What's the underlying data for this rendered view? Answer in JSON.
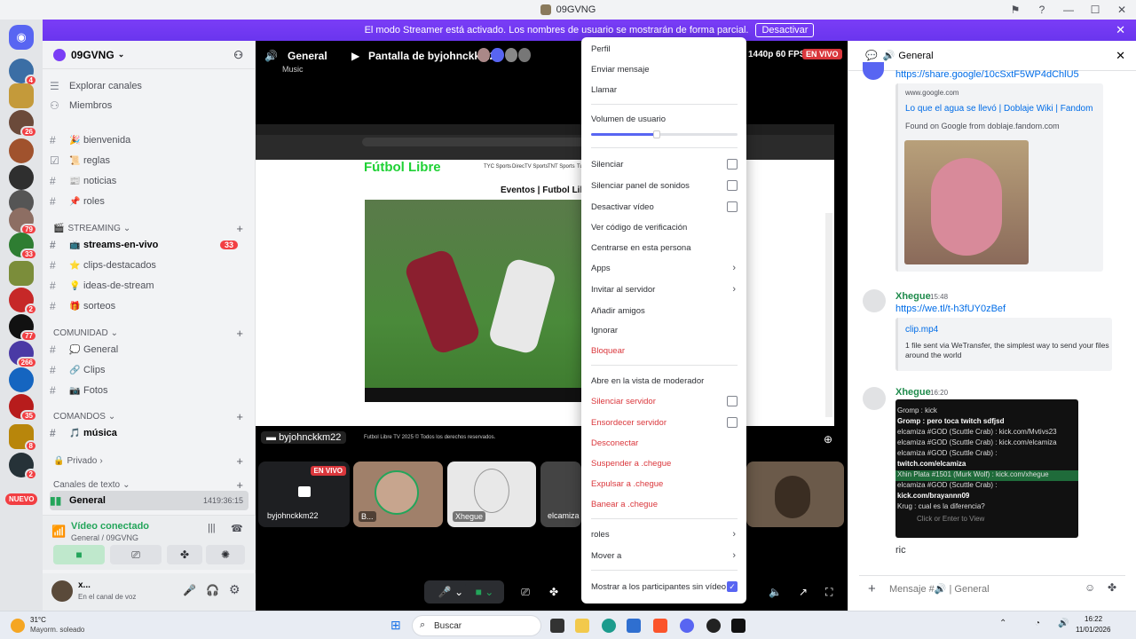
{
  "window": {
    "title": "09GVNG"
  },
  "banner": {
    "text": "El modo Streamer está activado. Los nombres de usuario se mostrarán de forma parcial.",
    "button": "Desactivar"
  },
  "guild_badges": [
    "4",
    "26",
    "",
    "",
    "",
    "79",
    "33",
    "",
    "2",
    "77",
    "266",
    "",
    "35",
    "8",
    "2"
  ],
  "new_badge": "NUEVO",
  "server": {
    "name": "09GVNG"
  },
  "nav": {
    "browse": "Explorar canales",
    "members": "Miembros"
  },
  "channels_top": [
    {
      "emoji": "🎉",
      "name": "bienvenida"
    },
    {
      "emoji": "📜",
      "name": "reglas"
    },
    {
      "emoji": "📰",
      "name": "noticias"
    },
    {
      "emoji": "📌",
      "name": "roles"
    }
  ],
  "cat_streaming": "STREAMING",
  "channels_streaming": [
    {
      "emoji": "📺",
      "name": "streams-en-vivo",
      "count": "33"
    },
    {
      "emoji": "⭐",
      "name": "clips-destacados",
      "count": ""
    },
    {
      "emoji": "💡",
      "name": "ideas-de-stream",
      "count": ""
    },
    {
      "emoji": "🎁",
      "name": "sorteos",
      "count": ""
    }
  ],
  "cat_comunidad": "COMUNIDAD",
  "channels_comunidad": [
    {
      "emoji": "💭",
      "name": "General"
    },
    {
      "emoji": "🔗",
      "name": "Clips"
    },
    {
      "emoji": "📷",
      "name": "Fotos"
    }
  ],
  "cat_comandos": "COMANDOS",
  "channel_musica": {
    "emoji": "🎵",
    "name": "música"
  },
  "cat_private": "Privade",
  "cat_private_label": "Privado",
  "cat_text": "Canales de texto",
  "voice_channel": {
    "name": "General",
    "time": "1419:36:15"
  },
  "voice": {
    "status": "Vídeo conectado",
    "location": "General / 09GVNG"
  },
  "user": {
    "name": "x...",
    "status": "En el canal de voz"
  },
  "stage": {
    "channel": "General",
    "sub": "Music",
    "screen_title": "Pantalla de byjohnckkm22",
    "quality": "1440p 60 FPS",
    "live": "EN VIVO",
    "streamer_tag": "byjohnckkm22",
    "site_title": "Fútbol Libre",
    "site_sub": "Eventos | Futbol Libr",
    "site_footer": "Futbol Libre TV 2025 © Todos los derechos reservados.",
    "nav_links": [
      "TYC Sports",
      "DirecTV Sports",
      "TNT Sports",
      "Tu"
    ]
  },
  "tiles": [
    {
      "name": "byjohnckkm22",
      "live": "EN VIVO"
    },
    {
      "name": "B..."
    },
    {
      "name": "Xhegue"
    },
    {
      "name": "elcamiza"
    }
  ],
  "menu": {
    "profile": "Perfil",
    "send_message": "Enviar mensaje",
    "call": "Llamar",
    "volume": "Volumen de usuario",
    "volume_level": 0.45,
    "mute": "Silenciar",
    "mute_soundboard": "Silenciar panel de sonidos",
    "disable_video": "Desactivar vídeo",
    "verify": "Ver código de verificación",
    "focus": "Centrarse en esta persona",
    "apps": "Apps",
    "invite": "Invitar al servidor",
    "add_friend": "Añadir amigos",
    "ignore": "Ignorar",
    "block": "Bloquear",
    "mod_view": "Abre en la vista de moderador",
    "server_mute": "Silenciar servidor",
    "server_deafen": "Ensordecer servidor",
    "disconnect": "Desconectar",
    "suspend": "Suspender a .chegue",
    "kick": "Expulsar a .chegue",
    "ban": "Banear a .chegue",
    "roles": "roles",
    "move": "Mover a",
    "show_video": "Mostrar a los participantes sin vídeo"
  },
  "chat": {
    "header": "General",
    "top_link": "https://share.google/10cSxtF5WP4dChlU5",
    "embed1": {
      "site": "www.google.com",
      "title": "Lo que el agua se llevó | Doblaje Wiki | Fandom",
      "desc": "Found on Google from doblaje.fandom.com"
    },
    "msg1": {
      "author": "Xhegue",
      "time": "15:48",
      "link": "https://we.tl/t-h3fUY0zBef"
    },
    "embed2": {
      "title": "clip.mp4",
      "desc": "1 file sent via WeTransfer, the simplest way to send your files around the world"
    },
    "msg2": {
      "author": "Xhegue",
      "time": "16:20"
    },
    "chatlog": [
      "Gromp : kick",
      "Gromp : pero toca twitch sdfjsd",
      "elcamiza #GOD (Scuttle Crab) : kick.com/Mvtivs23",
      "elcamiza #GOD (Scuttle Crab) : kick.com/elcamiza",
      "elcamiza #GOD (Scuttle Crab) :",
      "twitch.com/elcamiza",
      "Xhin Plata #1501 (Murk Wolf) : kick.com/xhegue",
      "elcamiza #GOD (Scuttle Crab) :",
      "kick.com/brayannn09",
      "Krug : cual es la diferencia?"
    ],
    "chat_input_hint": "Click or Enter to View",
    "last_msg": "ric",
    "input_placeholder": "Mensaje #🔊 | General"
  },
  "taskbar": {
    "weather_temp": "31°C",
    "weather_desc": "Mayorm. soleado",
    "search": "Buscar",
    "time": "16:22",
    "date": "11/01/2026"
  }
}
